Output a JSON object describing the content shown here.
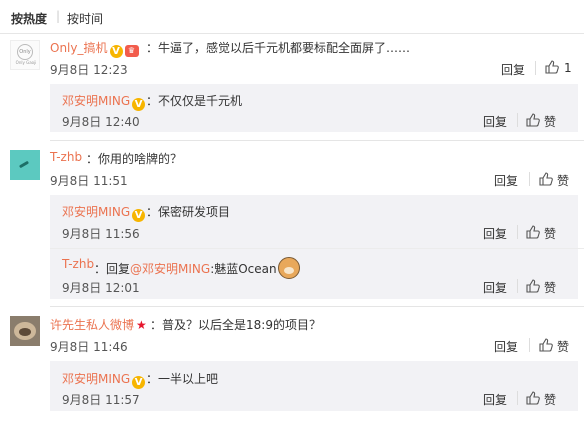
{
  "sort": {
    "hot": "按热度",
    "sep": "|",
    "time": "按时间"
  },
  "actions": {
    "reply": "回复",
    "like": "赞"
  },
  "comments": [
    {
      "user": "Only_搞机",
      "text": "：牛逼了，感觉以后千元机都要标配全面屏了……",
      "date": "9月8日 12:23",
      "avatar_text": "Only",
      "avatar_tag": "Only Gaoji",
      "replies": [
        {
          "user": "邓安明MING",
          "text": "：不仅仅是千元机",
          "date": "9月8日 12:40"
        }
      ]
    },
    {
      "user": "T-zhb",
      "text": "：你用的啥牌的？",
      "date": "9月8日 11:51",
      "replies": [
        {
          "user": "邓安明MING",
          "text": "：保密研发项目",
          "date": "9月8日 11:56"
        },
        {
          "user": "T-zhb",
          "text_prefix": "：回复",
          "mention": "@邓安明MING",
          "text_suffix": ":魅蓝Ocean",
          "date": "9月8日 12:01"
        }
      ]
    },
    {
      "user": "许先生私人微博",
      "text": "：普及？以后全是18:9的项目？",
      "date": "9月8日 11:46",
      "replies": [
        {
          "user": "邓安明MING",
          "text": "：一半以上吧",
          "date": "9月8日 11:57"
        }
      ]
    }
  ]
}
